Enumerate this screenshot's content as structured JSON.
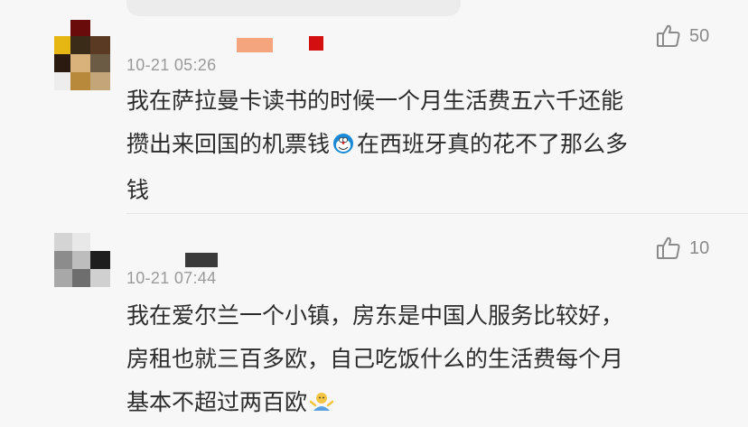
{
  "comments": [
    {
      "time": "10-21 05:26",
      "likes": "50",
      "text_line1": "我在萨拉曼卡读书的时候一个月生活费五六千还能",
      "text_line2a": "攒出来回国的机票钱",
      "emoji1": "doraemon-face-emoji",
      "text_line2b": "在西班牙真的花不了那么多",
      "text_line3": "钱"
    },
    {
      "time": "10-21 07:44",
      "likes": "10",
      "text_line1": "我在爱尔兰一个小镇，房东是中国人服务比较好，",
      "text_line2": "房租也就三百多欧，自己吃饭什么的生活费每个月",
      "text_line3a": "基本不超过两百欧",
      "emoji2": "shrug-emoji"
    }
  ],
  "colors": {
    "background": "#f7f7f7",
    "text": "#2c2c2c",
    "meta": "#9a9a9a"
  }
}
